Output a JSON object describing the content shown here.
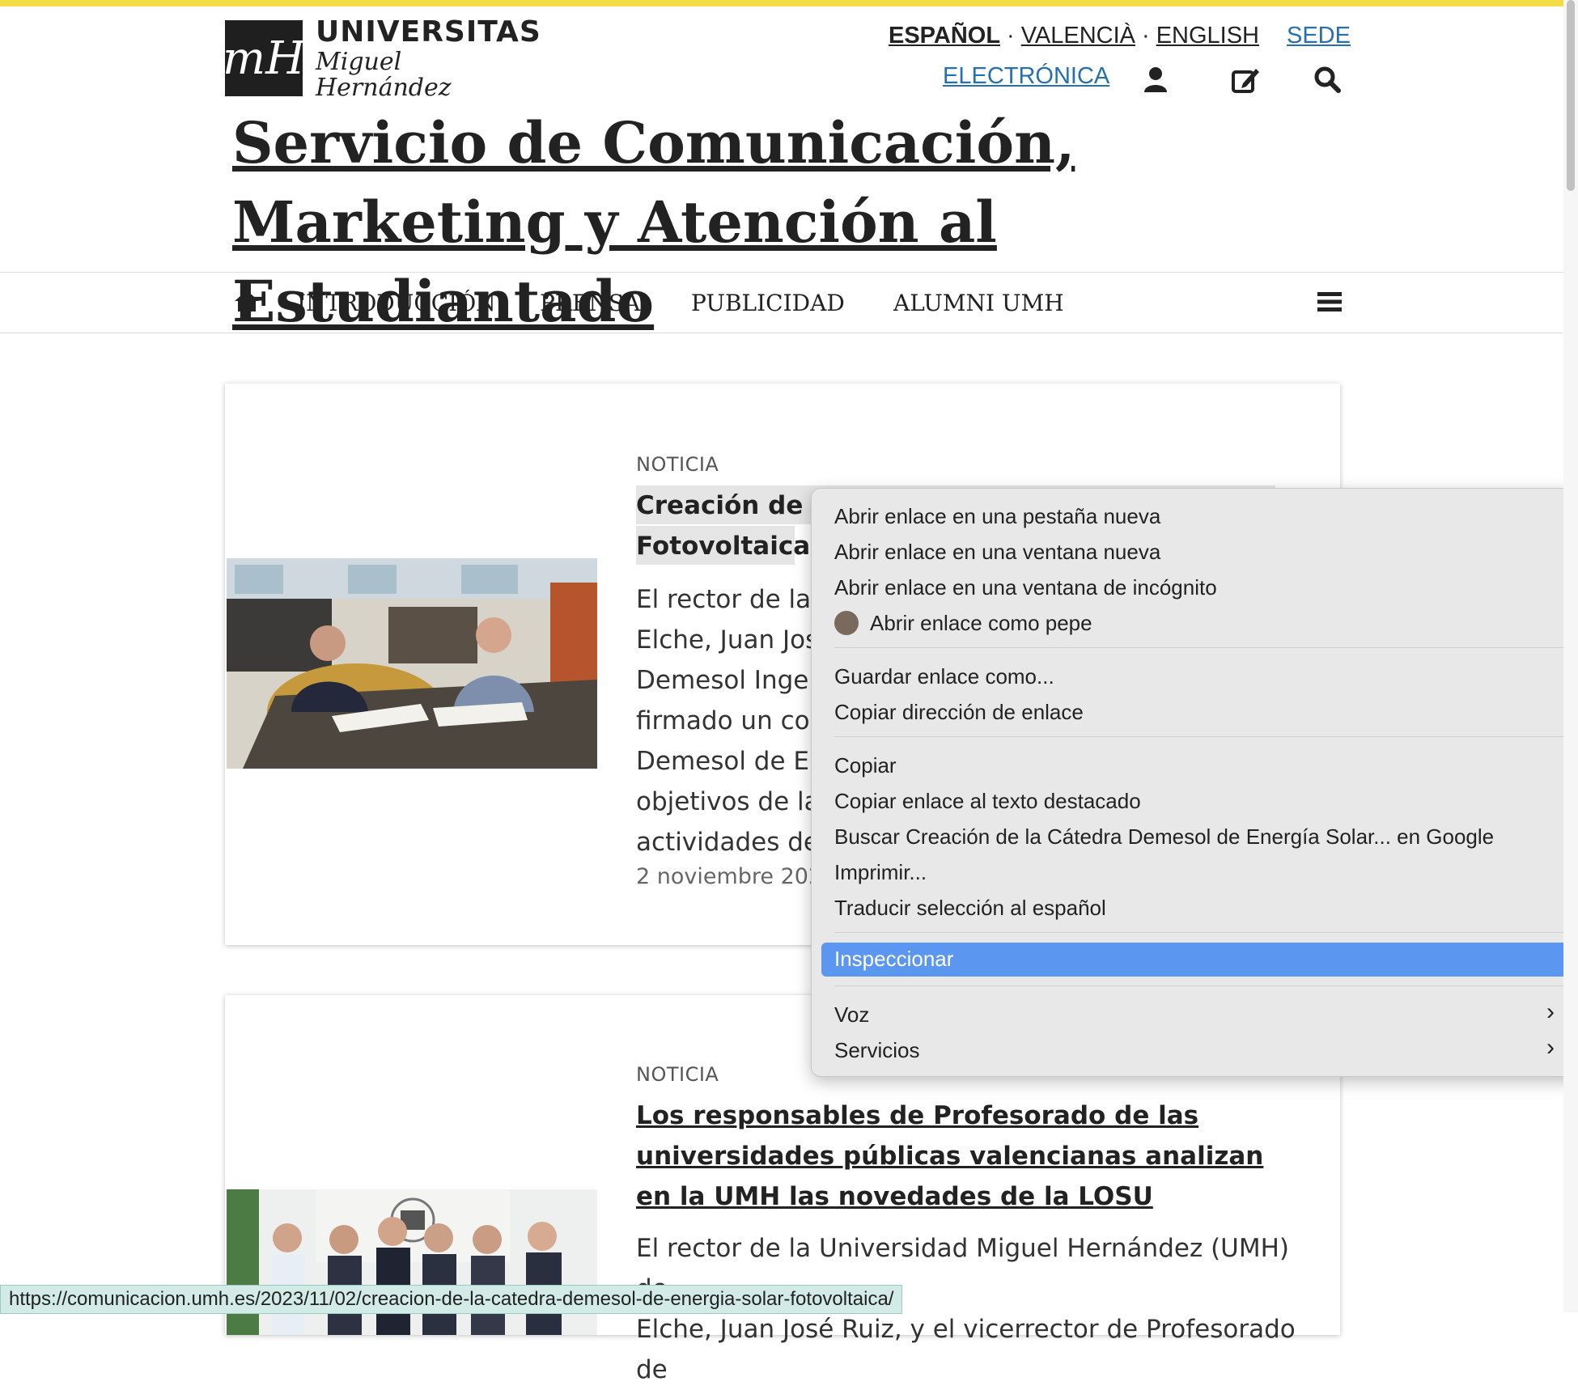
{
  "header": {
    "logo": {
      "mark": "mH",
      "title": "UNIVERSITAS",
      "subtitle": "Miguel Hernández"
    },
    "languages": [
      "ESPAÑOL",
      "VALENCIÀ",
      "ENGLISH"
    ],
    "language_separator": "·",
    "sede_label": "SEDE",
    "electronica_label": "ELECTRÓNICA",
    "icons": [
      "user-icon",
      "edit-icon",
      "search-icon"
    ],
    "site_title": "Servicio de Comunicación, Marketing y Atención al Estudiantado"
  },
  "nav": {
    "items": [
      "INTRODUCCIÓN",
      "PRENSA",
      "PUBLICIDAD",
      "ALUMNI UMH"
    ],
    "icons": [
      "home-icon",
      "menu-icon"
    ]
  },
  "cards": [
    {
      "kicker": "NOTICIA",
      "title_lines": [
        "Creación de la",
        "Fotovoltaica"
      ],
      "body_lines": [
        "El rector de la U",
        "Elche, Juan José",
        "Demesol Ingen",
        "firmado un con",
        "Demesol de En",
        "objetivos de la",
        "actividades de"
      ],
      "date": "2 noviembre 202"
    },
    {
      "kicker": "NOTICIA",
      "title": "Los responsables de Profesorado de las universidades públicas valencianas analizan en la UMH las novedades de la LOSU",
      "body_lines": [
        "El rector de la Universidad Miguel Hernández (UMH) de",
        "Elche, Juan José Ruiz, y el vicerrector de Profesorado de"
      ]
    }
  ],
  "context_menu": {
    "items": [
      "Abrir enlace en una pestaña nueva",
      "Abrir enlace en una ventana nueva",
      "Abrir enlace en una ventana de incógnito",
      "Abrir enlace como pepe",
      "Guardar enlace como...",
      "Copiar dirección de enlace",
      "Copiar",
      "Copiar enlace al texto destacado",
      "Buscar Creación de la Cátedra Demesol de Energía Solar... en Google",
      "Imprimir...",
      "Traducir selección al español",
      "Inspeccionar",
      "Voz",
      "Servicios"
    ],
    "selected": "Inspeccionar",
    "submenu_chevron": "›"
  },
  "status_url": "https://comunicacion.umh.es/2023/11/02/creacion-de-la-catedra-demesol-de-energia-solar-fotovoltaica/",
  "colors": {
    "accent_yellow": "#f4dc45",
    "link_blue": "#2470b3",
    "menu_highlight": "#5b97f0",
    "status_bg": "#d2ebe6"
  }
}
